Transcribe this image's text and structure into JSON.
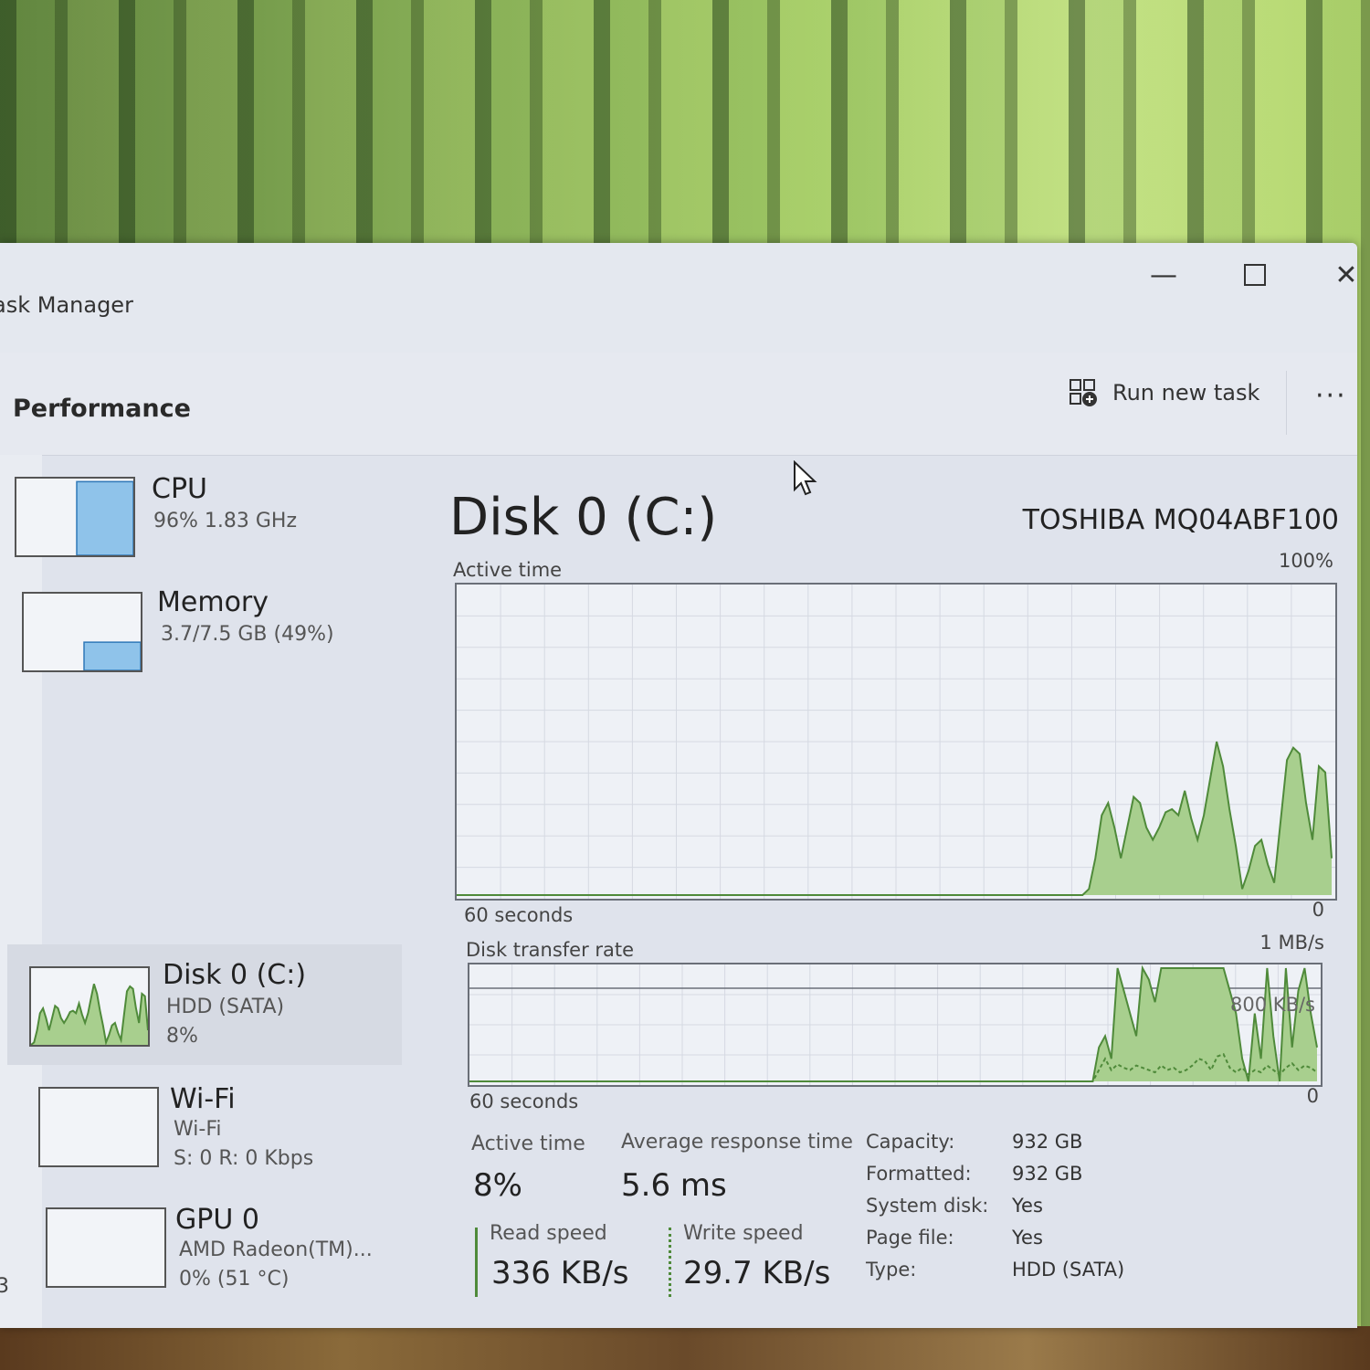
{
  "window": {
    "title": "ask Manager",
    "minimize": "—",
    "close": "✕"
  },
  "toolbar": {
    "section": "Performance",
    "run_new_task": "Run new task",
    "more": "···"
  },
  "sidebar": {
    "items": [
      {
        "name": "CPU",
        "line1": "96%  1.83 GHz",
        "line2": "",
        "selected": false,
        "level": 0.96
      },
      {
        "name": "Memory",
        "line1": "3.7/7.5 GB (49%)",
        "line2": "",
        "selected": false,
        "level": 0.49
      },
      {
        "name": "Disk 0 (C:)",
        "line1": "HDD (SATA)",
        "line2": "8%",
        "selected": true,
        "level": 0.08
      },
      {
        "name": "Wi-Fi",
        "line1": "Wi-Fi",
        "line2": "S: 0  R: 0 Kbps",
        "selected": false,
        "level": 0
      },
      {
        "name": "GPU 0",
        "line1": "AMD Radeon(TM)...",
        "line2": "0%  (51 °C)",
        "selected": false,
        "level": 0
      }
    ],
    "edge_number": "3"
  },
  "main": {
    "title": "Disk 0 (C:)",
    "model": "TOSHIBA MQ04ABF100",
    "active_time_graph": {
      "label": "Active time",
      "max_label": "100%",
      "x_label": "60 seconds",
      "min_label": "0",
      "values": [
        0,
        0,
        0,
        0,
        0,
        0,
        0,
        0,
        0,
        0,
        0,
        0,
        0,
        0,
        0,
        0,
        0,
        0,
        0,
        0,
        0,
        0,
        0,
        0,
        0,
        0,
        0,
        0,
        0,
        0,
        0,
        0,
        0,
        0,
        0,
        0,
        0,
        0,
        0,
        0,
        0,
        0,
        0,
        0,
        0,
        0,
        0,
        0,
        0,
        0,
        0,
        0,
        0,
        0,
        0,
        0,
        0,
        0,
        0,
        0,
        0,
        0,
        0,
        0,
        0,
        0,
        0,
        0,
        0,
        0,
        0,
        0,
        0,
        0,
        0,
        0,
        0,
        0,
        0,
        0,
        0,
        0,
        0,
        0,
        0,
        0,
        0,
        0,
        0,
        0,
        0,
        0,
        0,
        0,
        0,
        0,
        0,
        0,
        0,
        2,
        12,
        26,
        30,
        22,
        12,
        22,
        32,
        30,
        22,
        18,
        22,
        27,
        28,
        26,
        34,
        25,
        18,
        26,
        38,
        50,
        42,
        28,
        16,
        2,
        8,
        16,
        18,
        10,
        4,
        24,
        44,
        48,
        46,
        30,
        18,
        42,
        40,
        12
      ]
    },
    "transfer_graph": {
      "label": "Disk transfer rate",
      "max_label": "1 MB/s",
      "mid_label": "800 KB/s",
      "x_label": "60 seconds",
      "min_label": "0",
      "read_values": [
        0,
        0,
        0,
        0,
        0,
        0,
        0,
        0,
        0,
        0,
        0,
        0,
        0,
        0,
        0,
        0,
        0,
        0,
        0,
        0,
        0,
        0,
        0,
        0,
        0,
        0,
        0,
        0,
        0,
        0,
        0,
        0,
        0,
        0,
        0,
        0,
        0,
        0,
        0,
        0,
        0,
        0,
        0,
        0,
        0,
        0,
        0,
        0,
        0,
        0,
        0,
        0,
        0,
        0,
        0,
        0,
        0,
        0,
        0,
        0,
        0,
        0,
        0,
        0,
        0,
        0,
        0,
        0,
        0,
        0,
        0,
        0,
        0,
        0,
        0,
        0,
        0,
        0,
        0,
        0,
        0,
        0,
        0,
        0,
        0,
        0,
        0,
        0,
        0,
        0,
        0,
        0,
        0,
        0,
        0,
        0,
        0,
        0,
        0,
        0,
        0,
        30,
        40,
        20,
        100,
        80,
        60,
        40,
        100,
        90,
        70,
        100,
        100,
        100,
        100,
        100,
        100,
        100,
        100,
        100,
        100,
        100,
        80,
        60,
        20,
        0,
        60,
        20,
        100,
        40,
        0,
        100,
        30,
        80,
        100,
        60,
        30
      ],
      "write_values": [
        0,
        0,
        0,
        0,
        0,
        0,
        0,
        0,
        0,
        0,
        0,
        0,
        0,
        0,
        0,
        0,
        0,
        0,
        0,
        0,
        0,
        0,
        0,
        0,
        0,
        0,
        0,
        0,
        0,
        0,
        0,
        0,
        0,
        0,
        0,
        0,
        0,
        0,
        0,
        0,
        0,
        0,
        0,
        0,
        0,
        0,
        0,
        0,
        0,
        0,
        0,
        0,
        0,
        0,
        0,
        0,
        0,
        0,
        0,
        0,
        0,
        0,
        0,
        0,
        0,
        0,
        0,
        0,
        0,
        0,
        0,
        0,
        0,
        0,
        0,
        0,
        0,
        0,
        0,
        0,
        0,
        0,
        0,
        0,
        0,
        0,
        0,
        0,
        0,
        0,
        0,
        0,
        0,
        0,
        0,
        0,
        0,
        0,
        0,
        0,
        0,
        10,
        20,
        10,
        15,
        12,
        10,
        14,
        12,
        10,
        8,
        14,
        10,
        12,
        8,
        10,
        14,
        20,
        18,
        10,
        22,
        24,
        12,
        8,
        12,
        6,
        10,
        8,
        14,
        10,
        6,
        12,
        16,
        10,
        14,
        12,
        8
      ]
    },
    "stats": {
      "active_time_label": "Active time",
      "active_time_value": "8%",
      "avg_response_label": "Average response time",
      "avg_response_value": "5.6 ms",
      "read_speed_label": "Read speed",
      "read_speed_value": "336 KB/s",
      "write_speed_label": "Write speed",
      "write_speed_value": "29.7 KB/s"
    },
    "properties": [
      {
        "key": "Capacity:",
        "value": "932 GB"
      },
      {
        "key": "Formatted:",
        "value": "932 GB"
      },
      {
        "key": "System disk:",
        "value": "Yes"
      },
      {
        "key": "Page file:",
        "value": "Yes"
      },
      {
        "key": "Type:",
        "value": "HDD (SATA)"
      }
    ]
  },
  "colors": {
    "accent_fill": "#a8cf8e",
    "accent_line": "#4f8a3a",
    "cpu_fill": "#8fc3ea",
    "cpu_line": "#2f78b8"
  }
}
